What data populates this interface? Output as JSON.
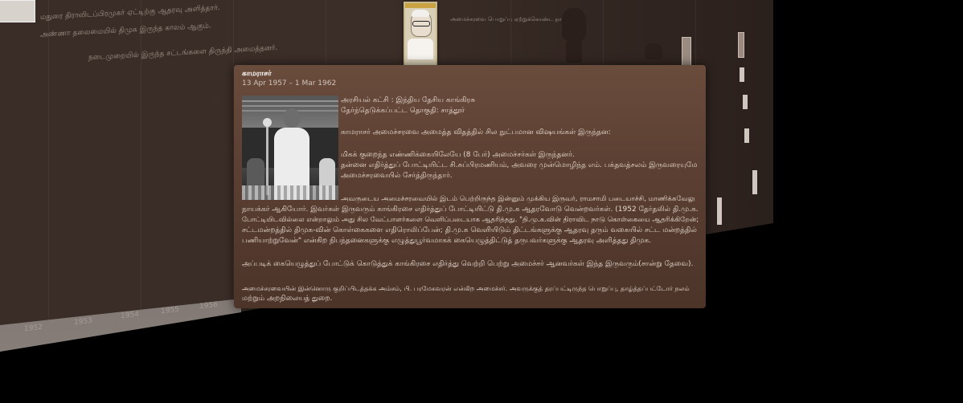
{
  "card": {
    "title": "காமராசர்",
    "dates": "13 Apr 1957 – 1 Mar 1962",
    "photo_icon": "person-speaking-photo",
    "lines": [
      "அரசியல் கட்சி : இந்திய தேசிய காங்கிரசு",
      "தேர்ந்தெடுக்கப்பட்ட தொகுதி: சாத்தூர்",
      "காமராசர் அமைச்சரவை அமைத்த விதத்தில் சில நுட்பமான விஷயங்கள் இருந்தன:",
      "மிகக் குறைந்த எண்ணிக்கையிலேயே (8 பேர்) அமைச்சர்கள் இருந்தனர்.",
      "தன்னை எதிர்த்துப் போட்டியிட்ட சி.சுப்பிரமணியம், அவரை முன்மொழிந்த எம். பக்தவத்சலம் இருவரையுமே",
      "அமைச்சரவையில் சேர்த்திருந்தார்.",
      "அவருடைய அமைச்சரவையில் இடம் பெற்றிருந்த இன்னும் முக்கிய இருவர், ராமசாமி படையாச்சி, மாணிக்கவேலு",
      "நாயக்கர் ஆகியோர். இவர்கள் இருவரும் காங்கிரசை எதிர்த்துப் போட்டியிட்டு தி.மு.க ஆதரவோடு வென்றவர்கள். (1952 தேர்தலில் தி.மு.க.",
      "போட்டியிடவில்லை என்றாலும் அது சில வேட்பாளர்களை வெளிப்படையாக ஆதரித்தது. \"தி.மு.க.வின் திராவிட நாடு கொள்கையை ஆதரிக்கிறேன்;",
      "சட்டமன்றத்தில் திமுக-வின் கொள்கைகளை எதிரொலிப்பேன்; தி.மு.க வெளியிடும் திட்டங்களுக்கு ஆதரவு தரும் வகையில் சட்ட மன்றத்தில்",
      "பணியாற்றுவேன்\" என்கிற நிபந்தனைகளுக்கு எழுத்துபூர்வமாகக் கையெழுத்திட்டுத் தருபவர்களுக்கு ஆதரவு அளித்தது திமுக.",
      "அப்படிக் கையெழுத்துப் போட்டுக் கொடுத்துக் காங்கிரசை எதிர்த்து வெற்றி பெற்று அமைச்சர் ஆனவர்கள் இந்த இருவரும்(சான்று தேவை).",
      "அமைச்சரவையின் இன்னொரு குறிப்பிடத்தக்க அம்சம், பி. பரமேசுவரன் என்கிற அமைச்சர். அவருக்குத் தரப்பட்டிருந்த பொறுப்பு, தாழ்த்தப்பட்டோர் நலம்",
      "மற்றும் அறநிலையத் துறை."
    ]
  },
  "timeline": {
    "years": [
      "1952",
      "1953",
      "1954",
      "1955",
      "1956"
    ]
  },
  "background_text": [
    "மதுரை திராவிடப்பிரமுகர் ஏட்டிற்கு ஆதரவு அளித்தார்.",
    "அண்ணா தலைமையில் திமுக இருந்த காலம் ஆகும்.",
    "நடைமுறையில் இருந்த சட்டங்களை திருத்தி அமைத்தனர்.",
    "அமைச்சரவை பொறுப்பு ஏற்றுக்கொண்ட நாள்."
  ],
  "colors": {
    "card_bg": "#5c4033",
    "wall_bg": "#3b2d27",
    "text": "#e5d8cf"
  }
}
